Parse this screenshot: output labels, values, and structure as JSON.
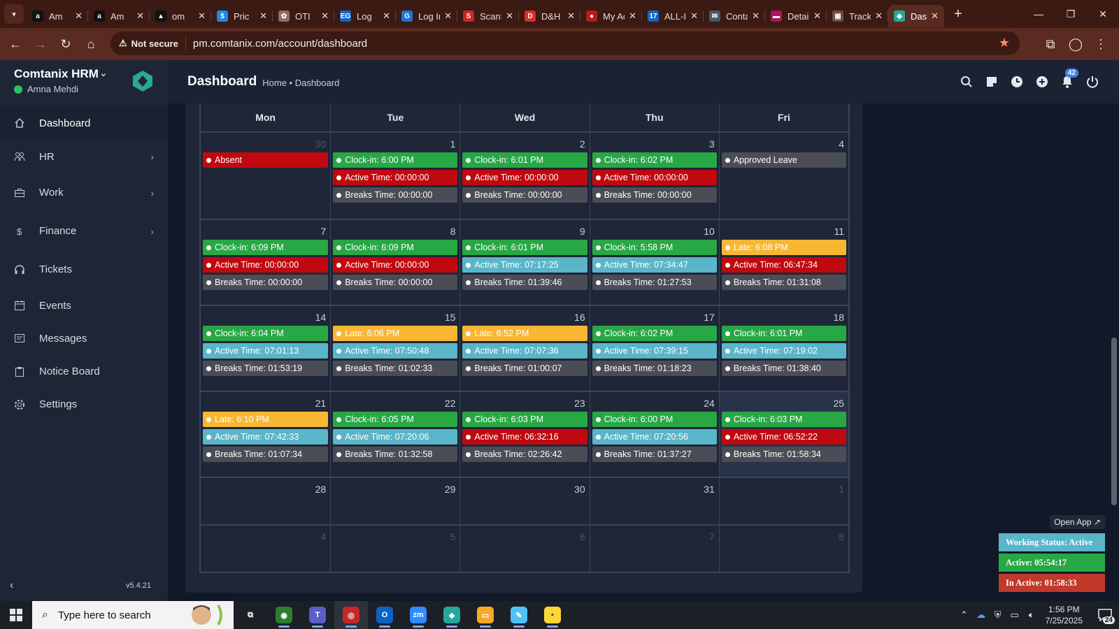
{
  "browser": {
    "tabs": [
      {
        "label": "Am",
        "fav": "a",
        "fav_color": "#111111"
      },
      {
        "label": "Am",
        "fav": "a",
        "fav_color": "#111111"
      },
      {
        "label": "om",
        "fav": "▲",
        "fav_color": "#111111"
      },
      {
        "label": "Pric",
        "fav": "$",
        "fav_color": "#1e88e5"
      },
      {
        "label": "OTI",
        "fav": "✿",
        "fav_color": "#8d6e63"
      },
      {
        "label": "Log",
        "fav": "EG",
        "fav_color": "#1565c0"
      },
      {
        "label": "Log In",
        "fav": "G",
        "fav_color": "#1976d2"
      },
      {
        "label": "ScanSo",
        "fav": "S",
        "fav_color": "#c62828"
      },
      {
        "label": "D&H Di",
        "fav": "D",
        "fav_color": "#d32f2f"
      },
      {
        "label": "My Acc",
        "fav": "●",
        "fav_color": "#b71c1c"
      },
      {
        "label": "ALL-IN-",
        "fav": "17",
        "fav_color": "#1565c0"
      },
      {
        "label": "Contact",
        "fav": "✉",
        "fav_color": "#455a64"
      },
      {
        "label": "Detailec",
        "fav": "▬",
        "fav_color": "#ad1457"
      },
      {
        "label": "Tracking",
        "fav": "▣",
        "fav_color": "#6d4c41"
      },
      {
        "label": "Das",
        "fav": "◆",
        "fav_color": "#26a69a",
        "active": true
      }
    ],
    "security_label": "Not secure",
    "url": "pm.comtanix.com/account/dashboard"
  },
  "app": {
    "brand": "Comtanix HRM",
    "user": "Amna Mehdi",
    "version": "v5.4.21",
    "page_title": "Dashboard",
    "breadcrumb": "Home • Dashboard",
    "notification_count": "42",
    "nav": [
      {
        "label": "Dashboard",
        "icon": "home-icon",
        "active": true
      },
      {
        "label": "HR",
        "icon": "users-icon",
        "chevron": true
      },
      {
        "label": "Work",
        "icon": "briefcase-icon",
        "chevron": true
      },
      {
        "label": "Finance",
        "icon": "dollar-icon",
        "chevron": true
      },
      {
        "label": "Tickets",
        "icon": "headset-icon"
      },
      {
        "label": "Events",
        "icon": "calendar-icon"
      },
      {
        "label": "Messages",
        "icon": "message-icon"
      },
      {
        "label": "Notice Board",
        "icon": "clipboard-icon"
      },
      {
        "label": "Settings",
        "icon": "gear-icon"
      }
    ]
  },
  "colors": {
    "green": "#28a745",
    "red": "#c0090f",
    "teal": "#5bb5c8",
    "gray": "#4a4d55",
    "yellow": "#f7b733"
  },
  "calendar": {
    "weekdays": [
      "Mon",
      "Tue",
      "Wed",
      "Thu",
      "Fri"
    ],
    "weeks": [
      [
        {
          "day": "30",
          "muted": true,
          "events": [
            {
              "text": "Absent",
              "color": "red"
            }
          ]
        },
        {
          "day": "1",
          "events": [
            {
              "text": "Clock-in: 6:00 PM",
              "color": "green"
            },
            {
              "text": "Active Time: 00:00:00",
              "color": "red"
            },
            {
              "text": "Breaks Time: 00:00:00",
              "color": "gray"
            }
          ]
        },
        {
          "day": "2",
          "events": [
            {
              "text": "Clock-in: 6:01 PM",
              "color": "green"
            },
            {
              "text": "Active Time: 00:00:00",
              "color": "red"
            },
            {
              "text": "Breaks Time: 00:00:00",
              "color": "gray"
            }
          ]
        },
        {
          "day": "3",
          "events": [
            {
              "text": "Clock-in: 6:02 PM",
              "color": "green"
            },
            {
              "text": "Active Time: 00:00:00",
              "color": "red"
            },
            {
              "text": "Breaks Time: 00:00:00",
              "color": "gray"
            }
          ]
        },
        {
          "day": "4",
          "events": [
            {
              "text": "Approved Leave",
              "color": "gray"
            }
          ]
        }
      ],
      [
        {
          "day": "7",
          "events": [
            {
              "text": "Clock-in: 6:09 PM",
              "color": "green"
            },
            {
              "text": "Active Time: 00:00:00",
              "color": "red"
            },
            {
              "text": "Breaks Time: 00:00:00",
              "color": "gray"
            }
          ]
        },
        {
          "day": "8",
          "events": [
            {
              "text": "Clock-in: 6:09 PM",
              "color": "green"
            },
            {
              "text": "Active Time: 00:00:00",
              "color": "red"
            },
            {
              "text": "Breaks Time: 00:00:00",
              "color": "gray"
            }
          ]
        },
        {
          "day": "9",
          "events": [
            {
              "text": "Clock-in: 6:01 PM",
              "color": "green"
            },
            {
              "text": "Active Time: 07:17:25",
              "color": "teal"
            },
            {
              "text": "Breaks Time: 01:39:46",
              "color": "gray"
            }
          ]
        },
        {
          "day": "10",
          "events": [
            {
              "text": "Clock-in: 5:58 PM",
              "color": "green"
            },
            {
              "text": "Active Time: 07:34:47",
              "color": "teal"
            },
            {
              "text": "Breaks Time: 01:27:53",
              "color": "gray"
            }
          ]
        },
        {
          "day": "11",
          "events": [
            {
              "text": "Late: 6:08 PM",
              "color": "yellow"
            },
            {
              "text": "Active Time: 06:47:34",
              "color": "red"
            },
            {
              "text": "Breaks Time: 01:31:08",
              "color": "gray"
            }
          ]
        }
      ],
      [
        {
          "day": "14",
          "events": [
            {
              "text": "Clock-in: 6:04 PM",
              "color": "green"
            },
            {
              "text": "Active Time: 07:01:13",
              "color": "teal"
            },
            {
              "text": "Breaks Time: 01:53:19",
              "color": "gray"
            }
          ]
        },
        {
          "day": "15",
          "events": [
            {
              "text": "Late: 6:06 PM",
              "color": "yellow"
            },
            {
              "text": "Active Time: 07:50:48",
              "color": "teal"
            },
            {
              "text": "Breaks Time: 01:02:33",
              "color": "gray"
            }
          ]
        },
        {
          "day": "16",
          "events": [
            {
              "text": "Late: 6:52 PM",
              "color": "yellow"
            },
            {
              "text": "Active Time: 07:07:36",
              "color": "teal"
            },
            {
              "text": "Breaks Time: 01:00:07",
              "color": "gray"
            }
          ]
        },
        {
          "day": "17",
          "events": [
            {
              "text": "Clock-in: 6:02 PM",
              "color": "green"
            },
            {
              "text": "Active Time: 07:39:15",
              "color": "teal"
            },
            {
              "text": "Breaks Time: 01:18:23",
              "color": "gray"
            }
          ]
        },
        {
          "day": "18",
          "events": [
            {
              "text": "Clock-in: 6:01 PM",
              "color": "green"
            },
            {
              "text": "Active Time: 07:19:02",
              "color": "teal"
            },
            {
              "text": "Breaks Time: 01:38:40",
              "color": "gray"
            }
          ]
        }
      ],
      [
        {
          "day": "21",
          "events": [
            {
              "text": "Late: 6:10 PM",
              "color": "yellow"
            },
            {
              "text": "Active Time: 07:42:33",
              "color": "teal"
            },
            {
              "text": "Breaks Time: 01:07:34",
              "color": "gray"
            }
          ]
        },
        {
          "day": "22",
          "events": [
            {
              "text": "Clock-in: 6:05 PM",
              "color": "green"
            },
            {
              "text": "Active Time: 07:20:06",
              "color": "teal"
            },
            {
              "text": "Breaks Time: 01:32:58",
              "color": "gray"
            }
          ]
        },
        {
          "day": "23",
          "events": [
            {
              "text": "Clock-in: 6:03 PM",
              "color": "green"
            },
            {
              "text": "Active Time: 06:32:16",
              "color": "red"
            },
            {
              "text": "Breaks Time: 02:26:42",
              "color": "gray"
            }
          ]
        },
        {
          "day": "24",
          "events": [
            {
              "text": "Clock-in: 6:00 PM",
              "color": "green"
            },
            {
              "text": "Active Time: 07:20:56",
              "color": "teal"
            },
            {
              "text": "Breaks Time: 01:37:27",
              "color": "gray"
            }
          ]
        },
        {
          "day": "25",
          "today": true,
          "events": [
            {
              "text": "Clock-in: 6:03 PM",
              "color": "green"
            },
            {
              "text": "Active Time: 06:52:22",
              "color": "red"
            },
            {
              "text": "Breaks Time: 01:58:34",
              "color": "gray"
            }
          ]
        }
      ],
      [
        {
          "day": "28",
          "events": []
        },
        {
          "day": "29",
          "events": []
        },
        {
          "day": "30",
          "events": []
        },
        {
          "day": "31",
          "events": []
        },
        {
          "day": "1",
          "muted": true,
          "events": []
        }
      ],
      [
        {
          "day": "4",
          "muted": true,
          "events": []
        },
        {
          "day": "5",
          "muted": true,
          "events": []
        },
        {
          "day": "6",
          "muted": true,
          "events": []
        },
        {
          "day": "7",
          "muted": true,
          "events": []
        },
        {
          "day": "8",
          "muted": true,
          "events": []
        }
      ]
    ]
  },
  "status_widget": {
    "open_app": "Open App ↗",
    "working_status": "Working Status: Active",
    "active": "Active: 05:54:17",
    "inactive": "In Active: 01:58:33"
  },
  "taskbar": {
    "search_placeholder": "Type here to search",
    "time": "1:56 PM",
    "date": "7/25/2025",
    "notification_count": "24",
    "apps": [
      {
        "name": "task-view",
        "glyph": "⧉",
        "color": "#1c1f26"
      },
      {
        "name": "chrome",
        "glyph": "◉",
        "color": "#2e7d32",
        "running": true
      },
      {
        "name": "teams",
        "glyph": "T",
        "color": "#5b5fc7",
        "running": true
      },
      {
        "name": "chrome-profile",
        "glyph": "◎",
        "color": "#c62828",
        "running": true,
        "active": true
      },
      {
        "name": "outlook",
        "glyph": "O",
        "color": "#0a64c4",
        "running": true
      },
      {
        "name": "zoom",
        "glyph": "zm",
        "color": "#2d8cff",
        "running": true
      },
      {
        "name": "comtanix",
        "glyph": "◆",
        "color": "#26a69a",
        "running": true
      },
      {
        "name": "file-explorer",
        "glyph": "▭",
        "color": "#f9a825",
        "running": true
      },
      {
        "name": "notepad",
        "glyph": "✎",
        "color": "#4fc3f7",
        "running": true
      },
      {
        "name": "sticky-notes",
        "glyph": "▪",
        "color": "#fdd835",
        "running": true
      }
    ]
  }
}
